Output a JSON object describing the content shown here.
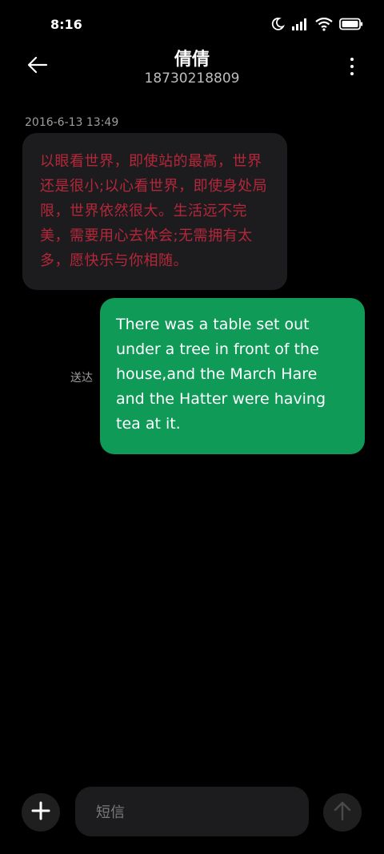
{
  "status_bar": {
    "time": "8:16",
    "icons": [
      "moon-icon",
      "signal-icon",
      "wifi-icon",
      "battery-icon"
    ]
  },
  "header": {
    "back_icon": "arrow-left-icon",
    "contact_name": "倩倩",
    "contact_number": "18730218809",
    "more_icon": "more-vertical-icon"
  },
  "conversation": {
    "timestamp": "2016-6-13 13:49",
    "messages": [
      {
        "direction": "incoming",
        "text": "以眼看世界，即使站的最高，世界还是很小;以心看世界，即使身处局限，世界依然很大。生活远不完美，需要用心去体会;无需拥有太多，愿快乐与你相随。",
        "text_color": "#b5273a",
        "bubble_color": "#1c1c1e"
      },
      {
        "direction": "outgoing",
        "text": "There was a table set out under a tree in front of the house,and the March Hare and the Hatter were having tea at it.",
        "status": "送达",
        "text_color": "#ffffff",
        "bubble_color": "#0f9a58"
      }
    ]
  },
  "composer": {
    "add_icon": "plus-icon",
    "placeholder": "短信",
    "send_icon": "arrow-up-icon"
  }
}
